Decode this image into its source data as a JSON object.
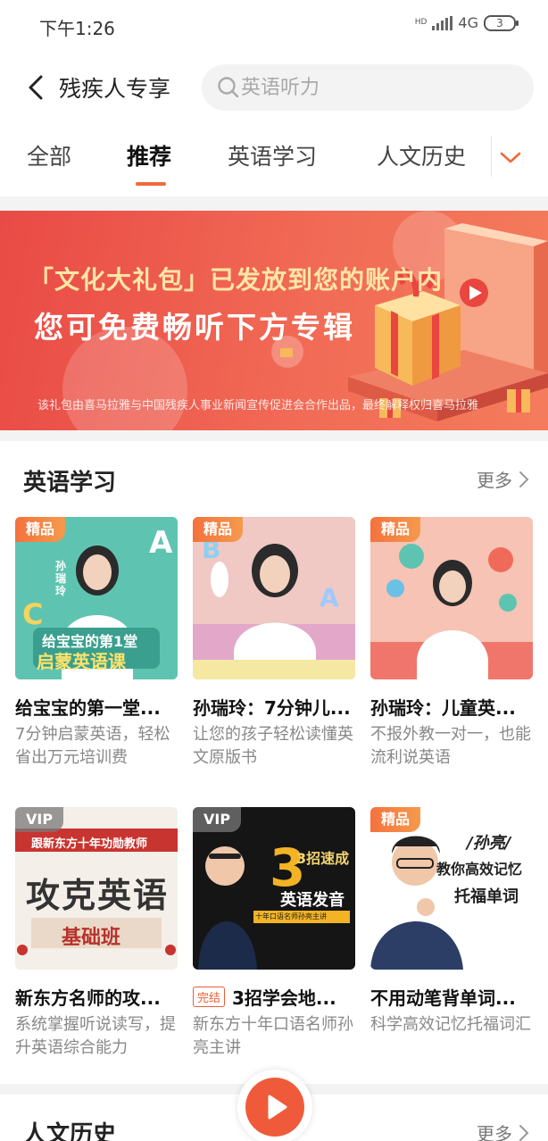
{
  "status": {
    "time": "下午1:26",
    "network": "4G",
    "battery": "3"
  },
  "header": {
    "title": "残疾人专享",
    "search_placeholder": "英语听力"
  },
  "tabs": [
    "全部",
    "推荐",
    "英语学习",
    "人文历史"
  ],
  "active_tab": 1,
  "banner": {
    "line1": "「文化大礼包」已发放到您的账户内",
    "line2": "您可免费畅听下方专辑",
    "footnote": "该礼包由喜马拉雅与中国残疾人事业新闻宣传促进会合作出品，最终解释权归喜马拉雅"
  },
  "section_english": {
    "title": "英语学习",
    "more": "更多",
    "cards": [
      {
        "badge": "精品",
        "cover_text": [
          "孙瑞玲",
          "给宝宝的第1堂",
          "启蒙英语课"
        ],
        "title": "给宝宝的第一堂...",
        "subtitle": "7分钟启蒙英语，轻松省出万元培训费",
        "done": ""
      },
      {
        "badge": "精品",
        "cover_text": [],
        "title": "孙瑞玲：7分钟儿...",
        "subtitle": "让您的孩子轻松读懂英文原版书",
        "done": ""
      },
      {
        "badge": "精品",
        "cover_text": [],
        "title": "孙瑞玲：儿童英...",
        "subtitle": "不报外教一对一，也能流利说英语",
        "done": ""
      },
      {
        "badge": "VIP",
        "cover_text": [
          "跟新东方十年功勋教师",
          "攻克英语",
          "基础班"
        ],
        "title": "新东方名师的攻...",
        "subtitle": "系统掌握听说读写，提升英语综合能力",
        "done": ""
      },
      {
        "badge": "VIP",
        "cover_text": [
          "3招速成",
          "英语发音",
          "十年口语名师孙亮主讲"
        ],
        "title": "3招学会地...",
        "subtitle": "新东方十年口语名师孙亮主讲",
        "done": "完结"
      },
      {
        "badge": "精品",
        "cover_text": [
          "/孙亮/",
          "教你高效记忆",
          "托福单词"
        ],
        "title": "不用动笔背单词...",
        "subtitle": "科学高效记忆托福词汇",
        "done": ""
      }
    ]
  },
  "section_history": {
    "title": "人文历史",
    "more": "更多"
  },
  "colors": {
    "accent": "#f06a3c",
    "banner": "#e94a45",
    "play": "#ef5b3a"
  }
}
